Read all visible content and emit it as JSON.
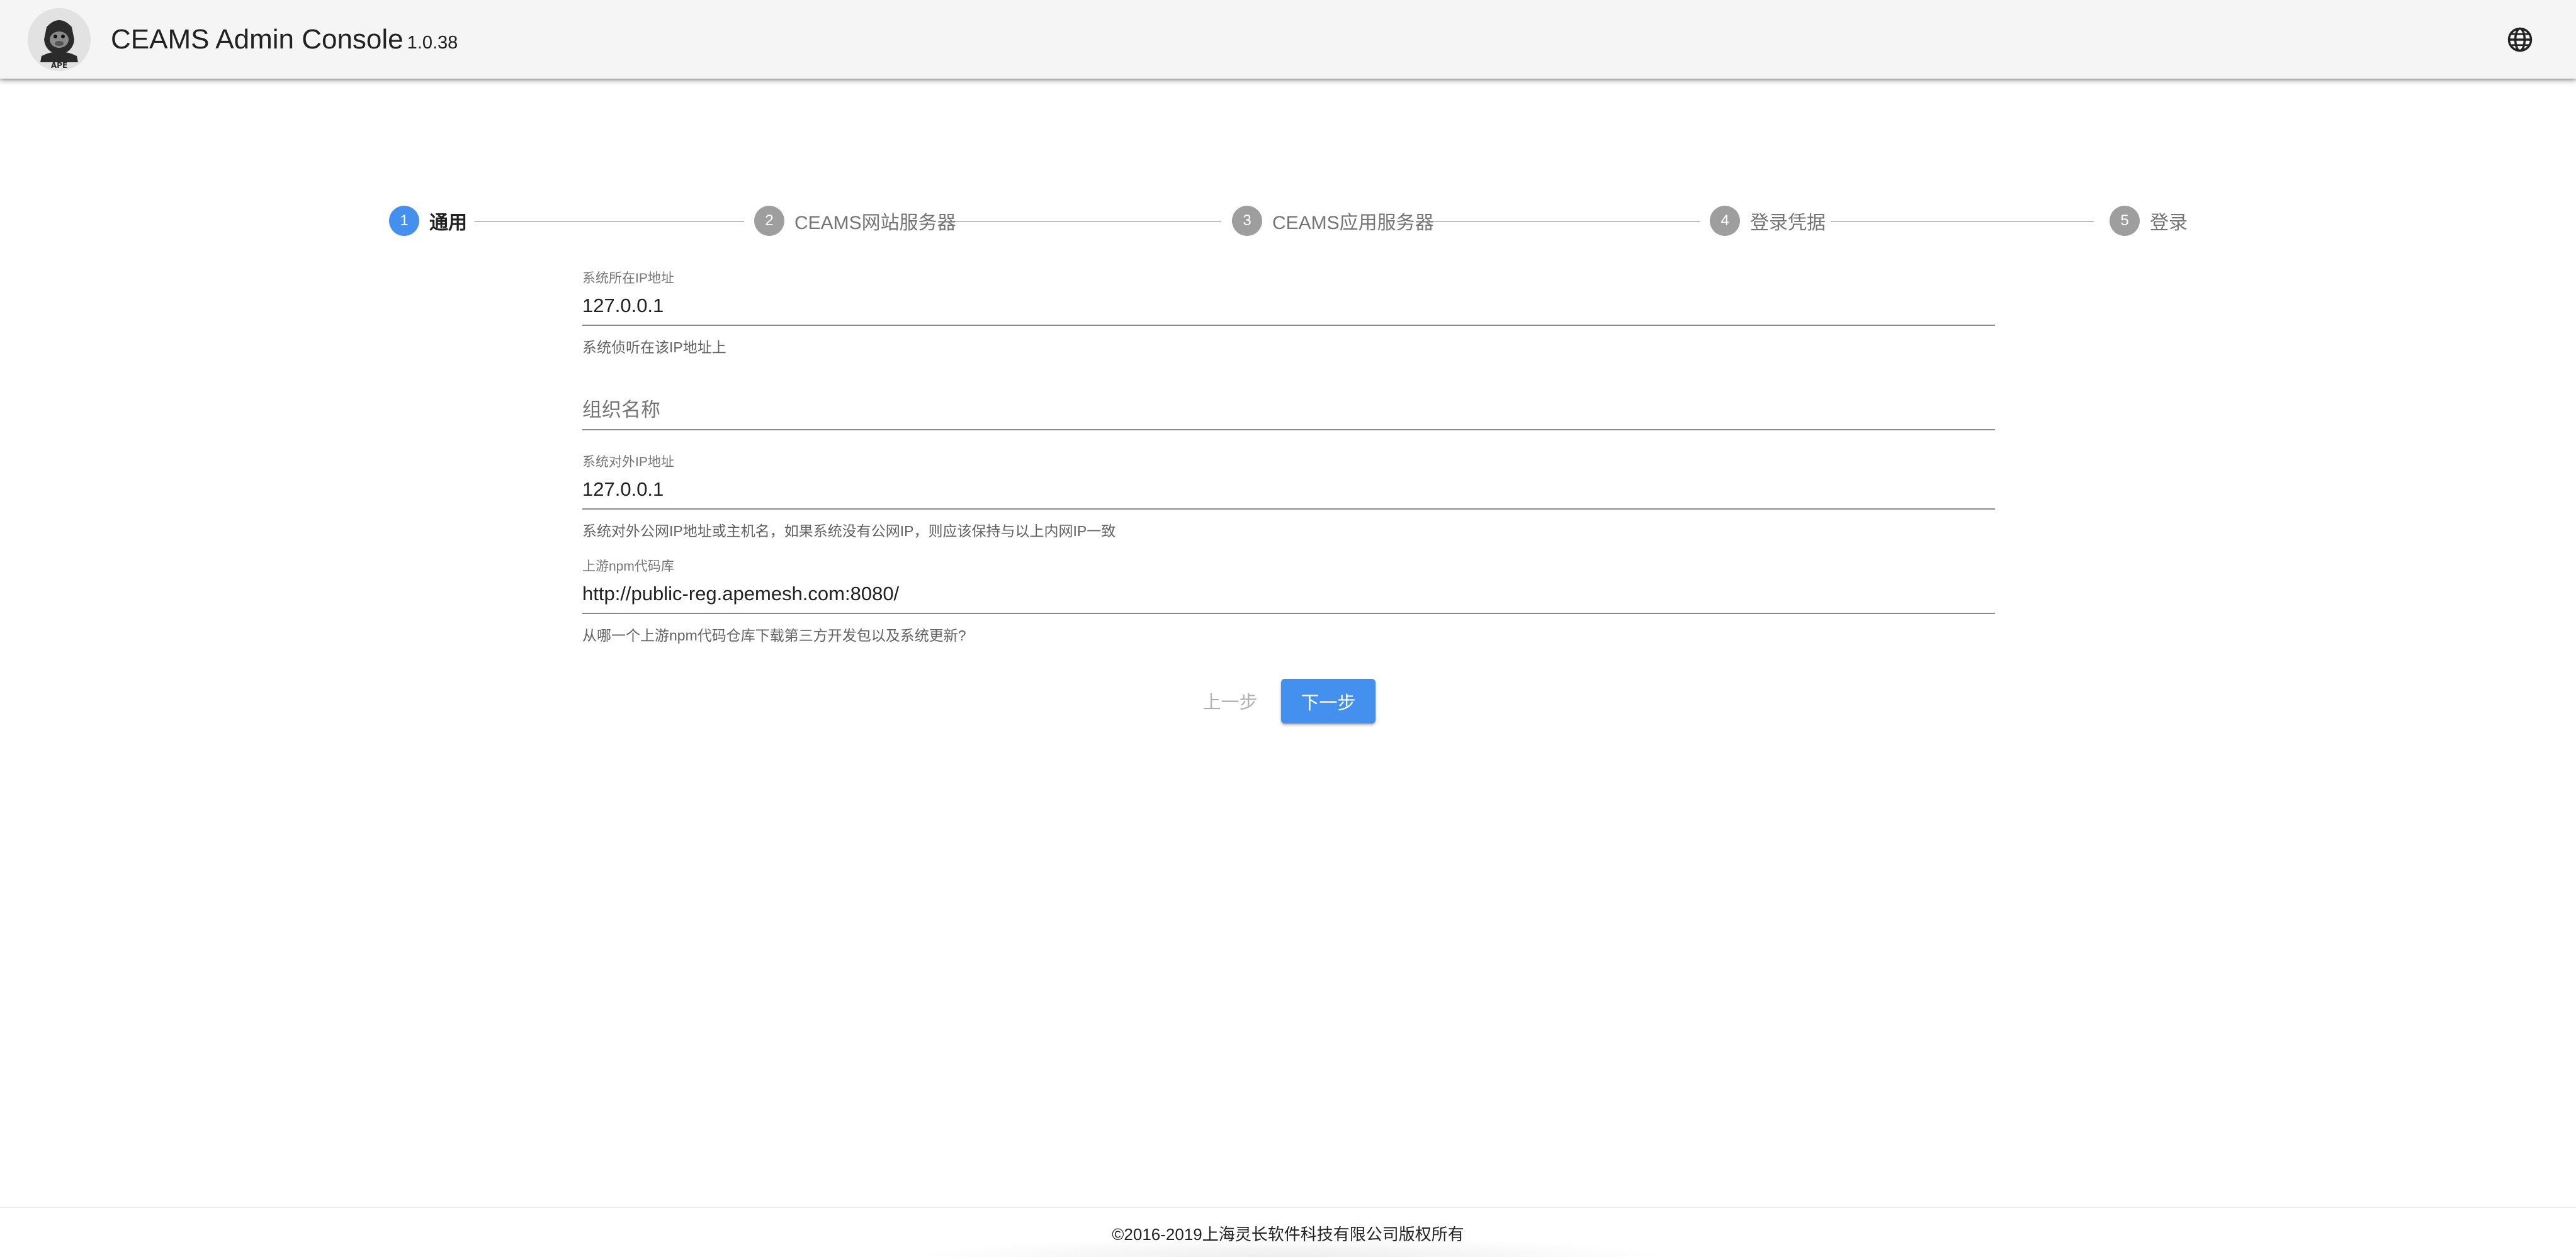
{
  "header": {
    "title": "CEAMS Admin Console",
    "version": "1.0.38",
    "logo_icon": "ape-gorilla-logo",
    "language_icon": "globe-icon"
  },
  "stepper": {
    "active_index": 0,
    "steps": [
      {
        "number": "1",
        "label": "通用"
      },
      {
        "number": "2",
        "label": "CEAMS网站服务器"
      },
      {
        "number": "3",
        "label": "CEAMS应用服务器"
      },
      {
        "number": "4",
        "label": "登录凭据"
      },
      {
        "number": "5",
        "label": "登录"
      }
    ]
  },
  "form": {
    "ip_address": {
      "label": "系统所在IP地址",
      "value": "127.0.0.1",
      "hint": "系统侦听在该IP地址上"
    },
    "org_name": {
      "placeholder": "组织名称",
      "value": ""
    },
    "public_ip": {
      "label": "系统对外IP地址",
      "value": "127.0.0.1",
      "hint": "系统对外公网IP地址或主机名，如果系统没有公网IP，则应该保持与以上内网IP一致"
    },
    "npm_registry": {
      "label": "上游npm代码库",
      "value": "http://public-reg.apemesh.com:8080/",
      "hint": "从哪一个上游npm代码仓库下载第三方开发包以及系统更新?"
    }
  },
  "actions": {
    "prev_label": "上一步",
    "next_label": "下一步"
  },
  "footer": {
    "copyright": "©2016-2019上海灵长软件科技有限公司版权所有"
  },
  "colors": {
    "primary": "#4390ee",
    "inactive_step": "#9e9e9e",
    "header_bg": "#f5f5f5"
  }
}
